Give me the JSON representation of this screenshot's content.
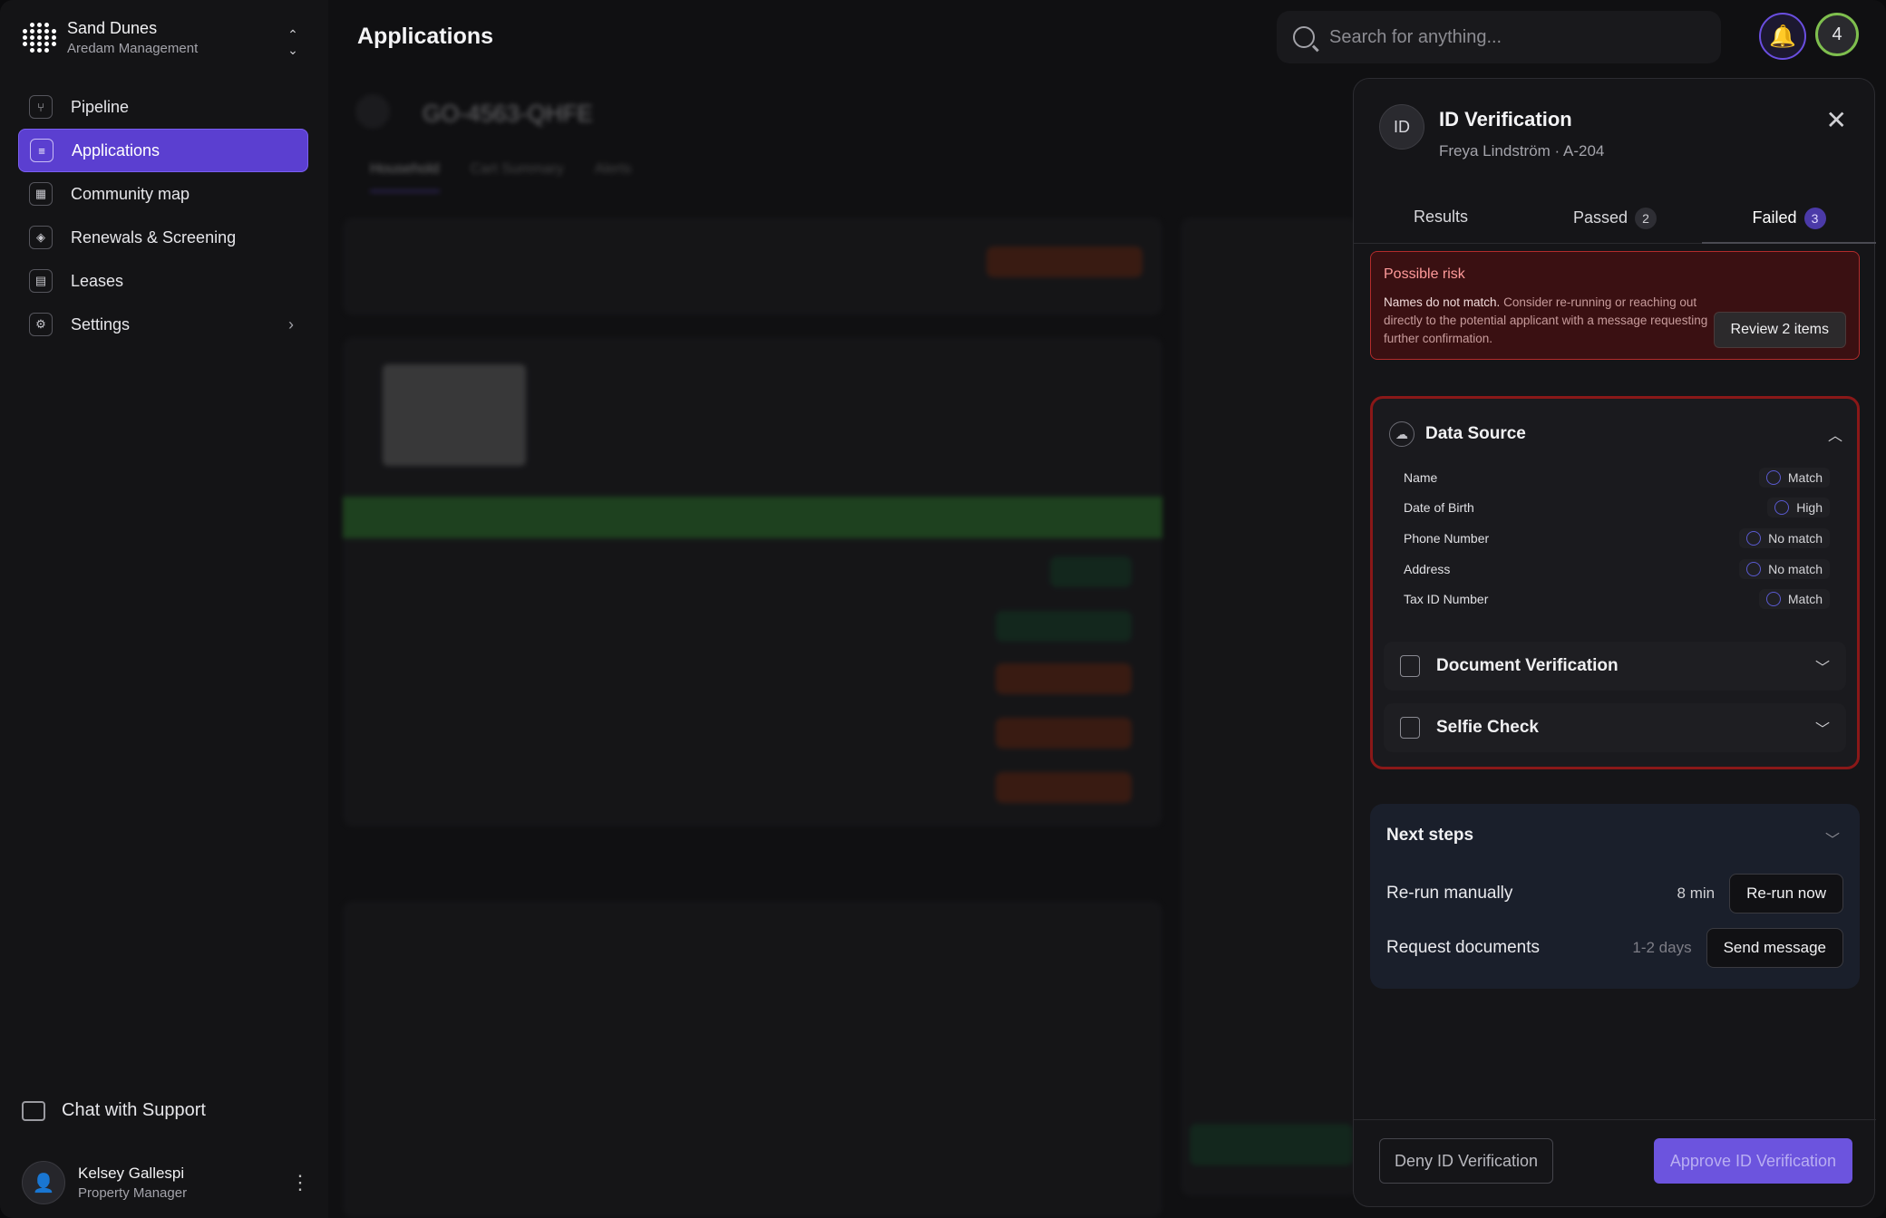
{
  "brand": {
    "name": "Sand Dunes",
    "org": "Aredam Management"
  },
  "nav": {
    "items": [
      {
        "label": "Pipeline"
      },
      {
        "label": "Applications"
      },
      {
        "label": "Community map"
      },
      {
        "label": "Renewals & Screening"
      },
      {
        "label": "Leases"
      },
      {
        "label": "Settings"
      }
    ]
  },
  "support": {
    "label": "Chat with Support"
  },
  "user": {
    "name": "Kelsey Gallespi",
    "role": "Property Manager"
  },
  "header": {
    "title": "Applications",
    "search_placeholder": "Search for anything...",
    "notification_count": "4"
  },
  "background": {
    "application_id": "GO-4563-QHFE",
    "tabs": [
      "Household",
      "Cart Summary",
      "Alerts"
    ]
  },
  "panel": {
    "badge": "ID",
    "title": "ID Verification",
    "subtitle": "Freya Lindström · A-204",
    "tabs": [
      {
        "label": "Results",
        "count": ""
      },
      {
        "label": "Passed",
        "count": "2"
      },
      {
        "label": "Failed",
        "count": "3"
      }
    ],
    "risk": {
      "title": "Possible risk",
      "lead": "Names do not match.",
      "text": " Consider re-running or reaching out directly to the potential applicant with a message requesting further confirmation.",
      "button": "Review 2 items"
    },
    "data_source": {
      "title": "Data Source",
      "rows": [
        {
          "field": "Name",
          "result": "Match"
        },
        {
          "field": "Date of Birth",
          "result": "High"
        },
        {
          "field": "Phone Number",
          "result": "No match"
        },
        {
          "field": "Address",
          "result": "No match"
        },
        {
          "field": "Tax ID Number",
          "result": "Match"
        }
      ]
    },
    "document_verification": {
      "title": "Document Verification"
    },
    "selfie_check": {
      "title": "Selfie Check"
    },
    "next_steps": {
      "title": "Next steps",
      "steps": [
        {
          "name": "Re-run manually",
          "time": "8 min",
          "button": "Re-run now"
        },
        {
          "name": "Request documents",
          "time": "1-2 days",
          "button": "Send message"
        }
      ]
    },
    "footer": {
      "deny": "Deny ID Verification",
      "approve": "Approve ID Verification"
    }
  }
}
